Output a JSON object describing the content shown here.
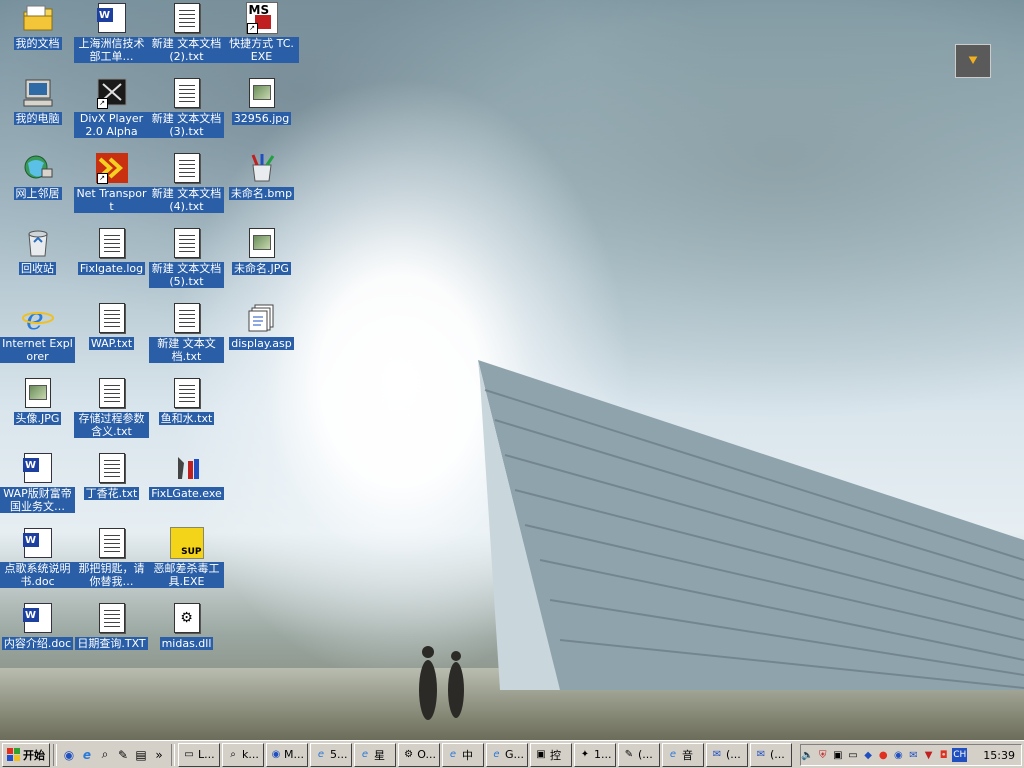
{
  "desktop": {
    "icons": [
      {
        "label": "我的文档"
      },
      {
        "label": "上海洲信技术部工单…"
      },
      {
        "label": "新建 文本文档 (2).txt"
      },
      {
        "label": "快捷方式 TC.EXE"
      },
      {
        "label": "我的电脑"
      },
      {
        "label": "DivX Player 2.0 Alpha"
      },
      {
        "label": "新建 文本文档 (3).txt"
      },
      {
        "label": "32956.jpg"
      },
      {
        "label": "网上邻居"
      },
      {
        "label": "Net Transport"
      },
      {
        "label": "新建 文本文档 (4).txt"
      },
      {
        "label": "未命名.bmp"
      },
      {
        "label": "回收站"
      },
      {
        "label": "Fixlgate.log"
      },
      {
        "label": "新建 文本文档 (5).txt"
      },
      {
        "label": "未命名.JPG"
      },
      {
        "label": "Internet Explorer"
      },
      {
        "label": "WAP.txt"
      },
      {
        "label": "新建 文本文档.txt"
      },
      {
        "label": "display.asp"
      },
      {
        "label": "头像.JPG"
      },
      {
        "label": "存储过程参数含义.txt"
      },
      {
        "label": "鱼和水.txt"
      },
      {
        "label": "WAP版财富帝国业务文…"
      },
      {
        "label": "丁香花.txt"
      },
      {
        "label": "FixLGate.exe"
      },
      {
        "label": "点歌系统说明书.doc"
      },
      {
        "label": "那把钥匙，请你替我…"
      },
      {
        "label": "恶邮差杀毒工具.EXE"
      },
      {
        "label": "内容介绍.doc"
      },
      {
        "label": "日期查询.TXT"
      },
      {
        "label": "midas.dll"
      }
    ],
    "ms_text": "MS",
    "sup_text": "SUP"
  },
  "taskbar": {
    "start_label": "开始",
    "more": "»",
    "tasks": [
      "L...",
      "k...",
      "M...",
      "5...",
      "星",
      "O...",
      "中",
      "G...",
      "控",
      "1...",
      "(...",
      "音",
      "(...",
      "(..."
    ],
    "tray_lang": "CH",
    "clock": "15:39"
  }
}
